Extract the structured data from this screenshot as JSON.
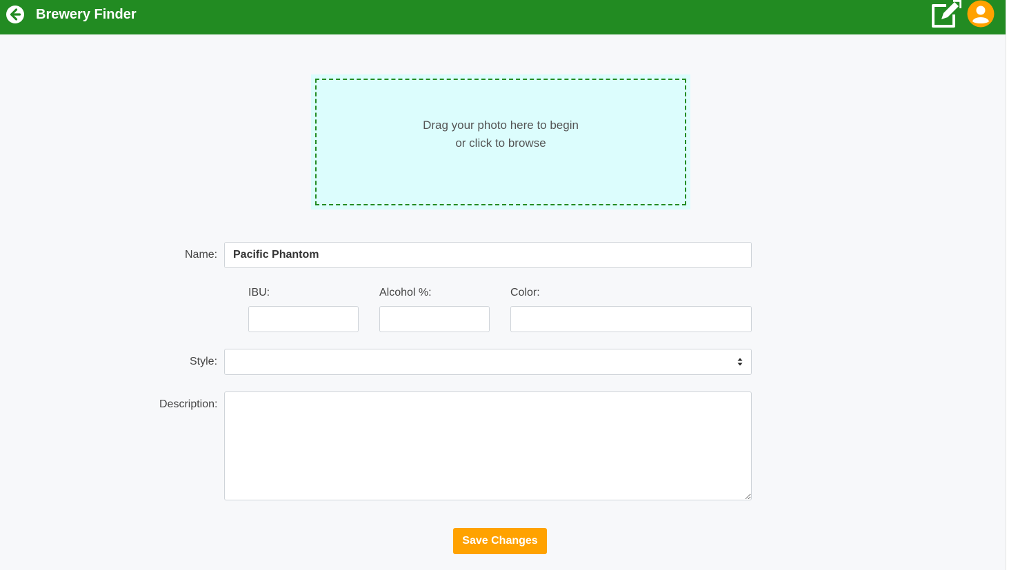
{
  "header": {
    "title": "Brewery Finder",
    "back_icon": "arrow-left-circle-icon",
    "edit_icon": "external-edit-icon",
    "account_icon": "user-circle-icon",
    "bar_color": "#228b22",
    "avatar_color": "#ffa200"
  },
  "upload": {
    "line1": "Drag your photo here to begin",
    "line2": "or click to browse",
    "background": "#dcfdfd",
    "border_color": "#228b22"
  },
  "form": {
    "name": {
      "label": "Name:",
      "value": "Pacific Phantom"
    },
    "ibu": {
      "label": "IBU:",
      "value": ""
    },
    "alcohol": {
      "label": "Alcohol %:",
      "value": ""
    },
    "color": {
      "label": "Color:",
      "value": ""
    },
    "style": {
      "label": "Style:",
      "value": ""
    },
    "description": {
      "label": "Description:",
      "value": ""
    }
  },
  "actions": {
    "save_label": "Save Changes",
    "save_color": "#ffa200"
  }
}
